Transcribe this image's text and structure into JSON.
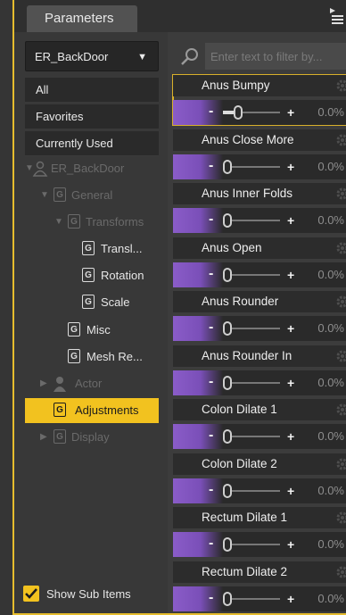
{
  "panel": {
    "tab_label": "Parameters",
    "figure_dropdown": "ER_BackDoor",
    "search_placeholder": "Enter text to filter by...",
    "show_sub_items": "Show Sub Items",
    "show_sub_items_checked": true,
    "accent_color": "#f2c21f",
    "slider_color": "#8a5cc8"
  },
  "filters": [
    {
      "label": "All"
    },
    {
      "label": "Favorites"
    },
    {
      "label": "Currently Used"
    }
  ],
  "tree": [
    {
      "label": "ER_BackDoor",
      "icon": "figure-icon",
      "expanded": true,
      "dimmed": true
    },
    {
      "label": "General",
      "icon": "group-icon",
      "expanded": true,
      "dimmed": true
    },
    {
      "label": "Transforms",
      "icon": "group-icon",
      "expanded": true,
      "dimmed": true
    },
    {
      "label": "Transl...",
      "icon": "group-icon"
    },
    {
      "label": "Rotation",
      "icon": "group-icon"
    },
    {
      "label": "Scale",
      "icon": "group-icon"
    },
    {
      "label": "Misc",
      "icon": "group-icon"
    },
    {
      "label": "Mesh Re...",
      "icon": "group-icon"
    },
    {
      "label": "Actor",
      "icon": "actor-icon",
      "expanded": false,
      "dimmed": true
    },
    {
      "label": "Adjustments",
      "icon": "group-icon",
      "selected": true
    },
    {
      "label": "Display",
      "icon": "group-icon",
      "expanded": false,
      "dimmed": true
    }
  ],
  "params": [
    {
      "name": "Anus Bumpy",
      "minus": "-",
      "plus": "+",
      "value": "0.0%",
      "slider": 0.22,
      "active": true
    },
    {
      "name": "Anus Close More",
      "minus": "-",
      "plus": "+",
      "value": "0.0%",
      "slider": 0.0
    },
    {
      "name": "Anus Inner Folds",
      "minus": "-",
      "plus": "+",
      "value": "0.0%",
      "slider": 0.0
    },
    {
      "name": "Anus Open",
      "minus": "-",
      "plus": "+",
      "value": "0.0%",
      "slider": 0.0
    },
    {
      "name": "Anus Rounder",
      "minus": "-",
      "plus": "+",
      "value": "0.0%",
      "slider": 0.0
    },
    {
      "name": "Anus Rounder In",
      "minus": "-",
      "plus": "+",
      "value": "0.0%",
      "slider": 0.0
    },
    {
      "name": "Colon Dilate 1",
      "minus": "-",
      "plus": "+",
      "value": "0.0%",
      "slider": 0.0
    },
    {
      "name": "Colon Dilate 2",
      "minus": "-",
      "plus": "+",
      "value": "0.0%",
      "slider": 0.0
    },
    {
      "name": "Rectum Dilate 1",
      "minus": "-",
      "plus": "+",
      "value": "0.0%",
      "slider": 0.0
    },
    {
      "name": "Rectum Dilate 2",
      "minus": "-",
      "plus": "+",
      "value": "0.0%",
      "slider": 0.0
    }
  ]
}
